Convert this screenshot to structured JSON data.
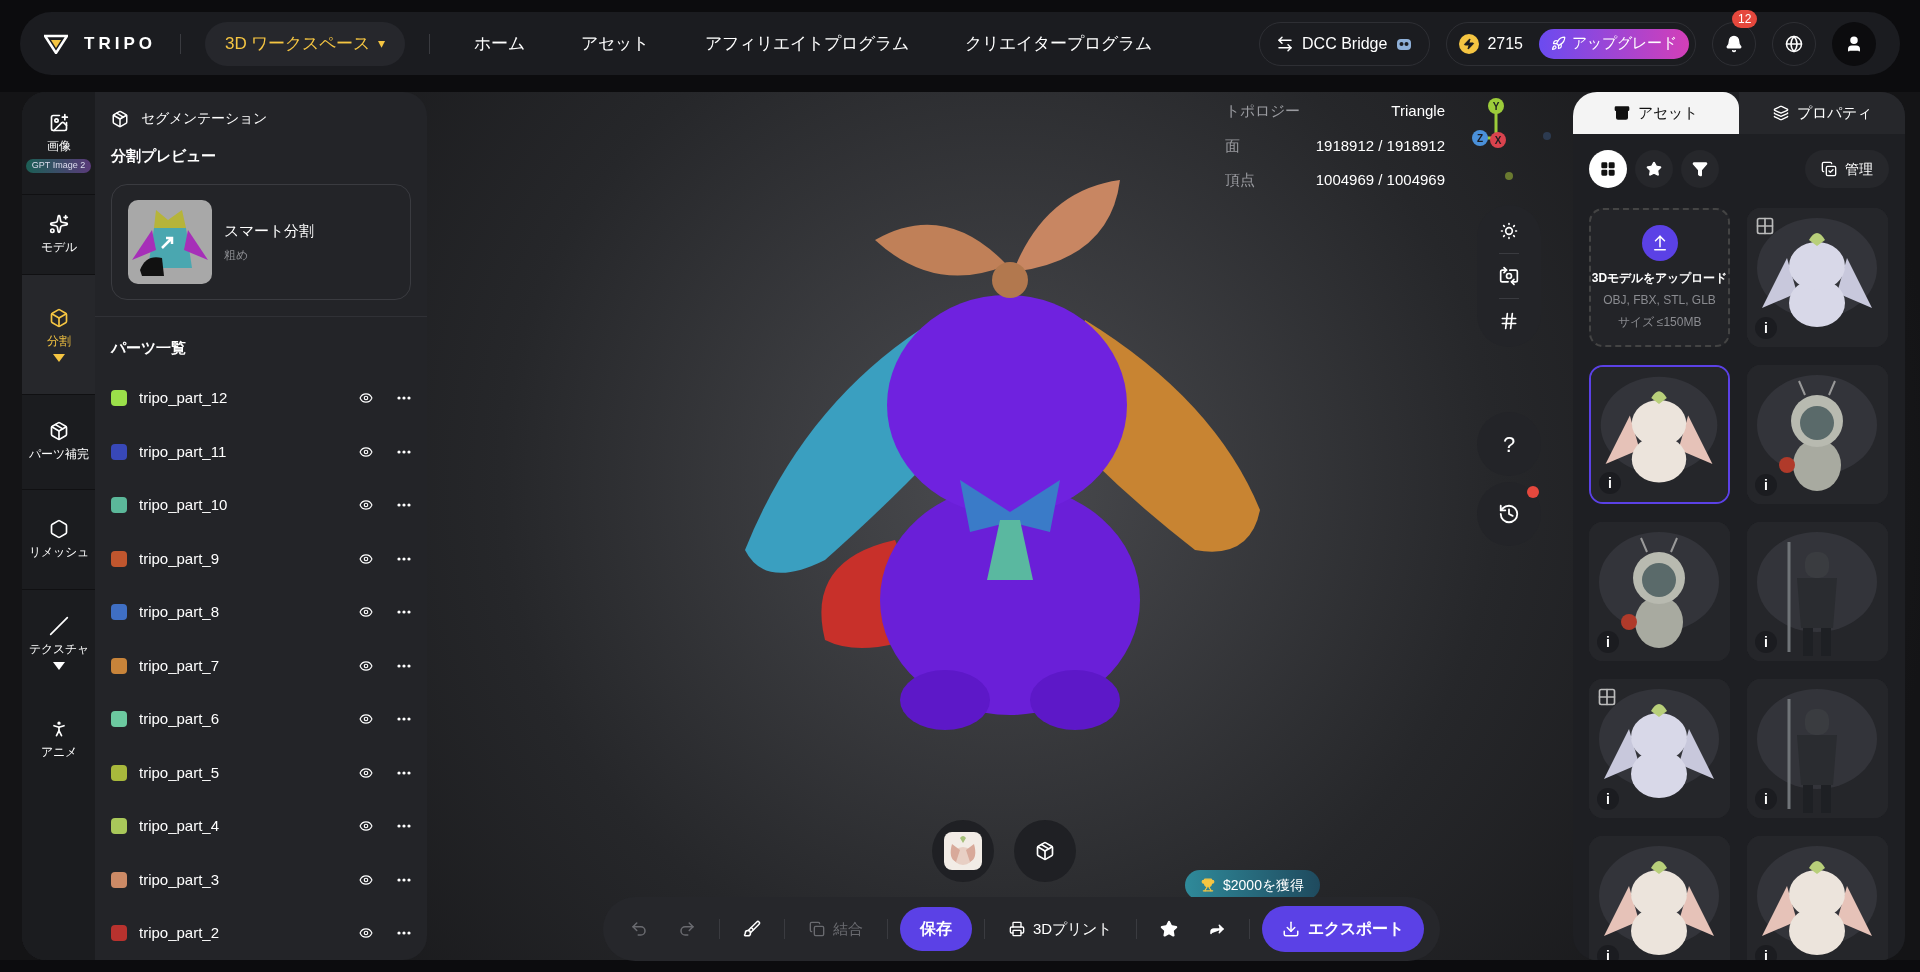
{
  "header": {
    "logo": "TRIPO",
    "workspace": {
      "label": "3D ワークスペース",
      "caret": "▾"
    },
    "nav": [
      {
        "label": "ホーム",
        "selected": false
      },
      {
        "label": "アセット",
        "selected": false
      },
      {
        "label": "アフィリエイトプログラム",
        "selected": false
      },
      {
        "label": "クリエイタープログラム",
        "selected": false
      }
    ],
    "bridge": "DCC Bridge",
    "credits": "2715",
    "upgrade": "アップグレード",
    "notifications": "12"
  },
  "rail": [
    {
      "label": "画像",
      "badge": "GPT Image 2",
      "selected": false,
      "dropdown": false
    },
    {
      "label": "モデル",
      "selected": false,
      "dropdown": false
    },
    {
      "label": "分割",
      "selected": true,
      "dropdown": true
    },
    {
      "label": "パーツ補完",
      "selected": false,
      "dropdown": false
    },
    {
      "label": "リメッシュ",
      "selected": false,
      "dropdown": false
    },
    {
      "label": "テクスチャ",
      "selected": false,
      "dropdown": true
    },
    {
      "label": "アニメ",
      "selected": false,
      "dropdown": false
    }
  ],
  "panel": {
    "title": "セグメンテーション",
    "preview_heading": "分割プレビュー",
    "preview": {
      "title": "スマート分割",
      "subtitle": "粗め"
    },
    "parts_heading": "パーツ一覧",
    "parts": [
      {
        "name": "tripo_part_12",
        "color": "#9be04a",
        "visible": true
      },
      {
        "name": "tripo_part_11",
        "color": "#3848b8",
        "visible": true
      },
      {
        "name": "tripo_part_10",
        "color": "#5bb89a",
        "visible": true
      },
      {
        "name": "tripo_part_9",
        "color": "#c0562e",
        "visible": true
      },
      {
        "name": "tripo_part_8",
        "color": "#3f6fc4",
        "visible": true
      },
      {
        "name": "tripo_part_7",
        "color": "#c8843a",
        "visible": true
      },
      {
        "name": "tripo_part_6",
        "color": "#6cc9a0",
        "visible": true
      },
      {
        "name": "tripo_part_5",
        "color": "#a8b83c",
        "visible": true
      },
      {
        "name": "tripo_part_4",
        "color": "#a9c85a",
        "visible": true
      },
      {
        "name": "tripo_part_3",
        "color": "#cc8a66",
        "visible": true
      },
      {
        "name": "tripo_part_2",
        "color": "#b8322e",
        "visible": true
      }
    ]
  },
  "stats": [
    {
      "label": "トポロジー",
      "value": "Triangle"
    },
    {
      "label": "面",
      "value": "1918912 / 1918912"
    },
    {
      "label": "頂点",
      "value": "1004969 / 1004969"
    }
  ],
  "gizmo": {
    "y": "Y",
    "z": "Z",
    "x": "X"
  },
  "history_alert": true,
  "help": "?",
  "reward": "$2000を獲得",
  "toolbar": [
    [
      {
        "kind": "undo",
        "disabled": true
      },
      {
        "kind": "redo",
        "disabled": true
      }
    ],
    [
      {
        "kind": "brush",
        "disabled": false
      }
    ],
    [
      {
        "kind": "merge",
        "label": "結合",
        "disabled": true
      }
    ],
    [
      {
        "kind": "save",
        "label": "保存",
        "disabled": false
      }
    ],
    [
      {
        "kind": "print",
        "label": "3Dプリント",
        "disabled": false
      }
    ],
    [
      {
        "kind": "favorite",
        "disabled": false
      },
      {
        "kind": "share",
        "disabled": false
      }
    ],
    [
      {
        "kind": "export",
        "label": "エクスポート",
        "disabled": false
      }
    ]
  ],
  "assets_panel": {
    "tabs": [
      {
        "label": "アセット",
        "selected": true
      },
      {
        "label": "プロパティ",
        "selected": false
      }
    ],
    "filters": [
      {
        "kind": "all",
        "selected": true
      },
      {
        "kind": "favorite",
        "selected": false
      },
      {
        "kind": "filter",
        "selected": false
      }
    ],
    "manage": "管理",
    "upload": {
      "title": "3Dモデルをアップロード",
      "formats": "OBJ, FBX, STL, GLB",
      "size": "サイズ ≤150MB"
    },
    "assets": [
      {
        "kind": "bunny",
        "wireframe": true,
        "selected": false,
        "info": "i"
      },
      {
        "kind": "bunny",
        "wireframe": false,
        "selected": true,
        "info": "i"
      },
      {
        "kind": "robot",
        "wireframe": false,
        "selected": false,
        "info": "i"
      },
      {
        "kind": "robot",
        "wireframe": false,
        "selected": false,
        "info": "i"
      },
      {
        "kind": "warrior",
        "wireframe": false,
        "selected": false,
        "info": "i"
      },
      {
        "kind": "bunny",
        "wireframe": true,
        "selected": false,
        "info": "i"
      },
      {
        "kind": "warrior",
        "wireframe": false,
        "selected": false,
        "info": "i"
      },
      {
        "kind": "bunny",
        "wireframe": false,
        "selected": false,
        "info": "i"
      },
      {
        "kind": "bunny",
        "wireframe": false,
        "selected": false,
        "info": "i"
      }
    ]
  }
}
